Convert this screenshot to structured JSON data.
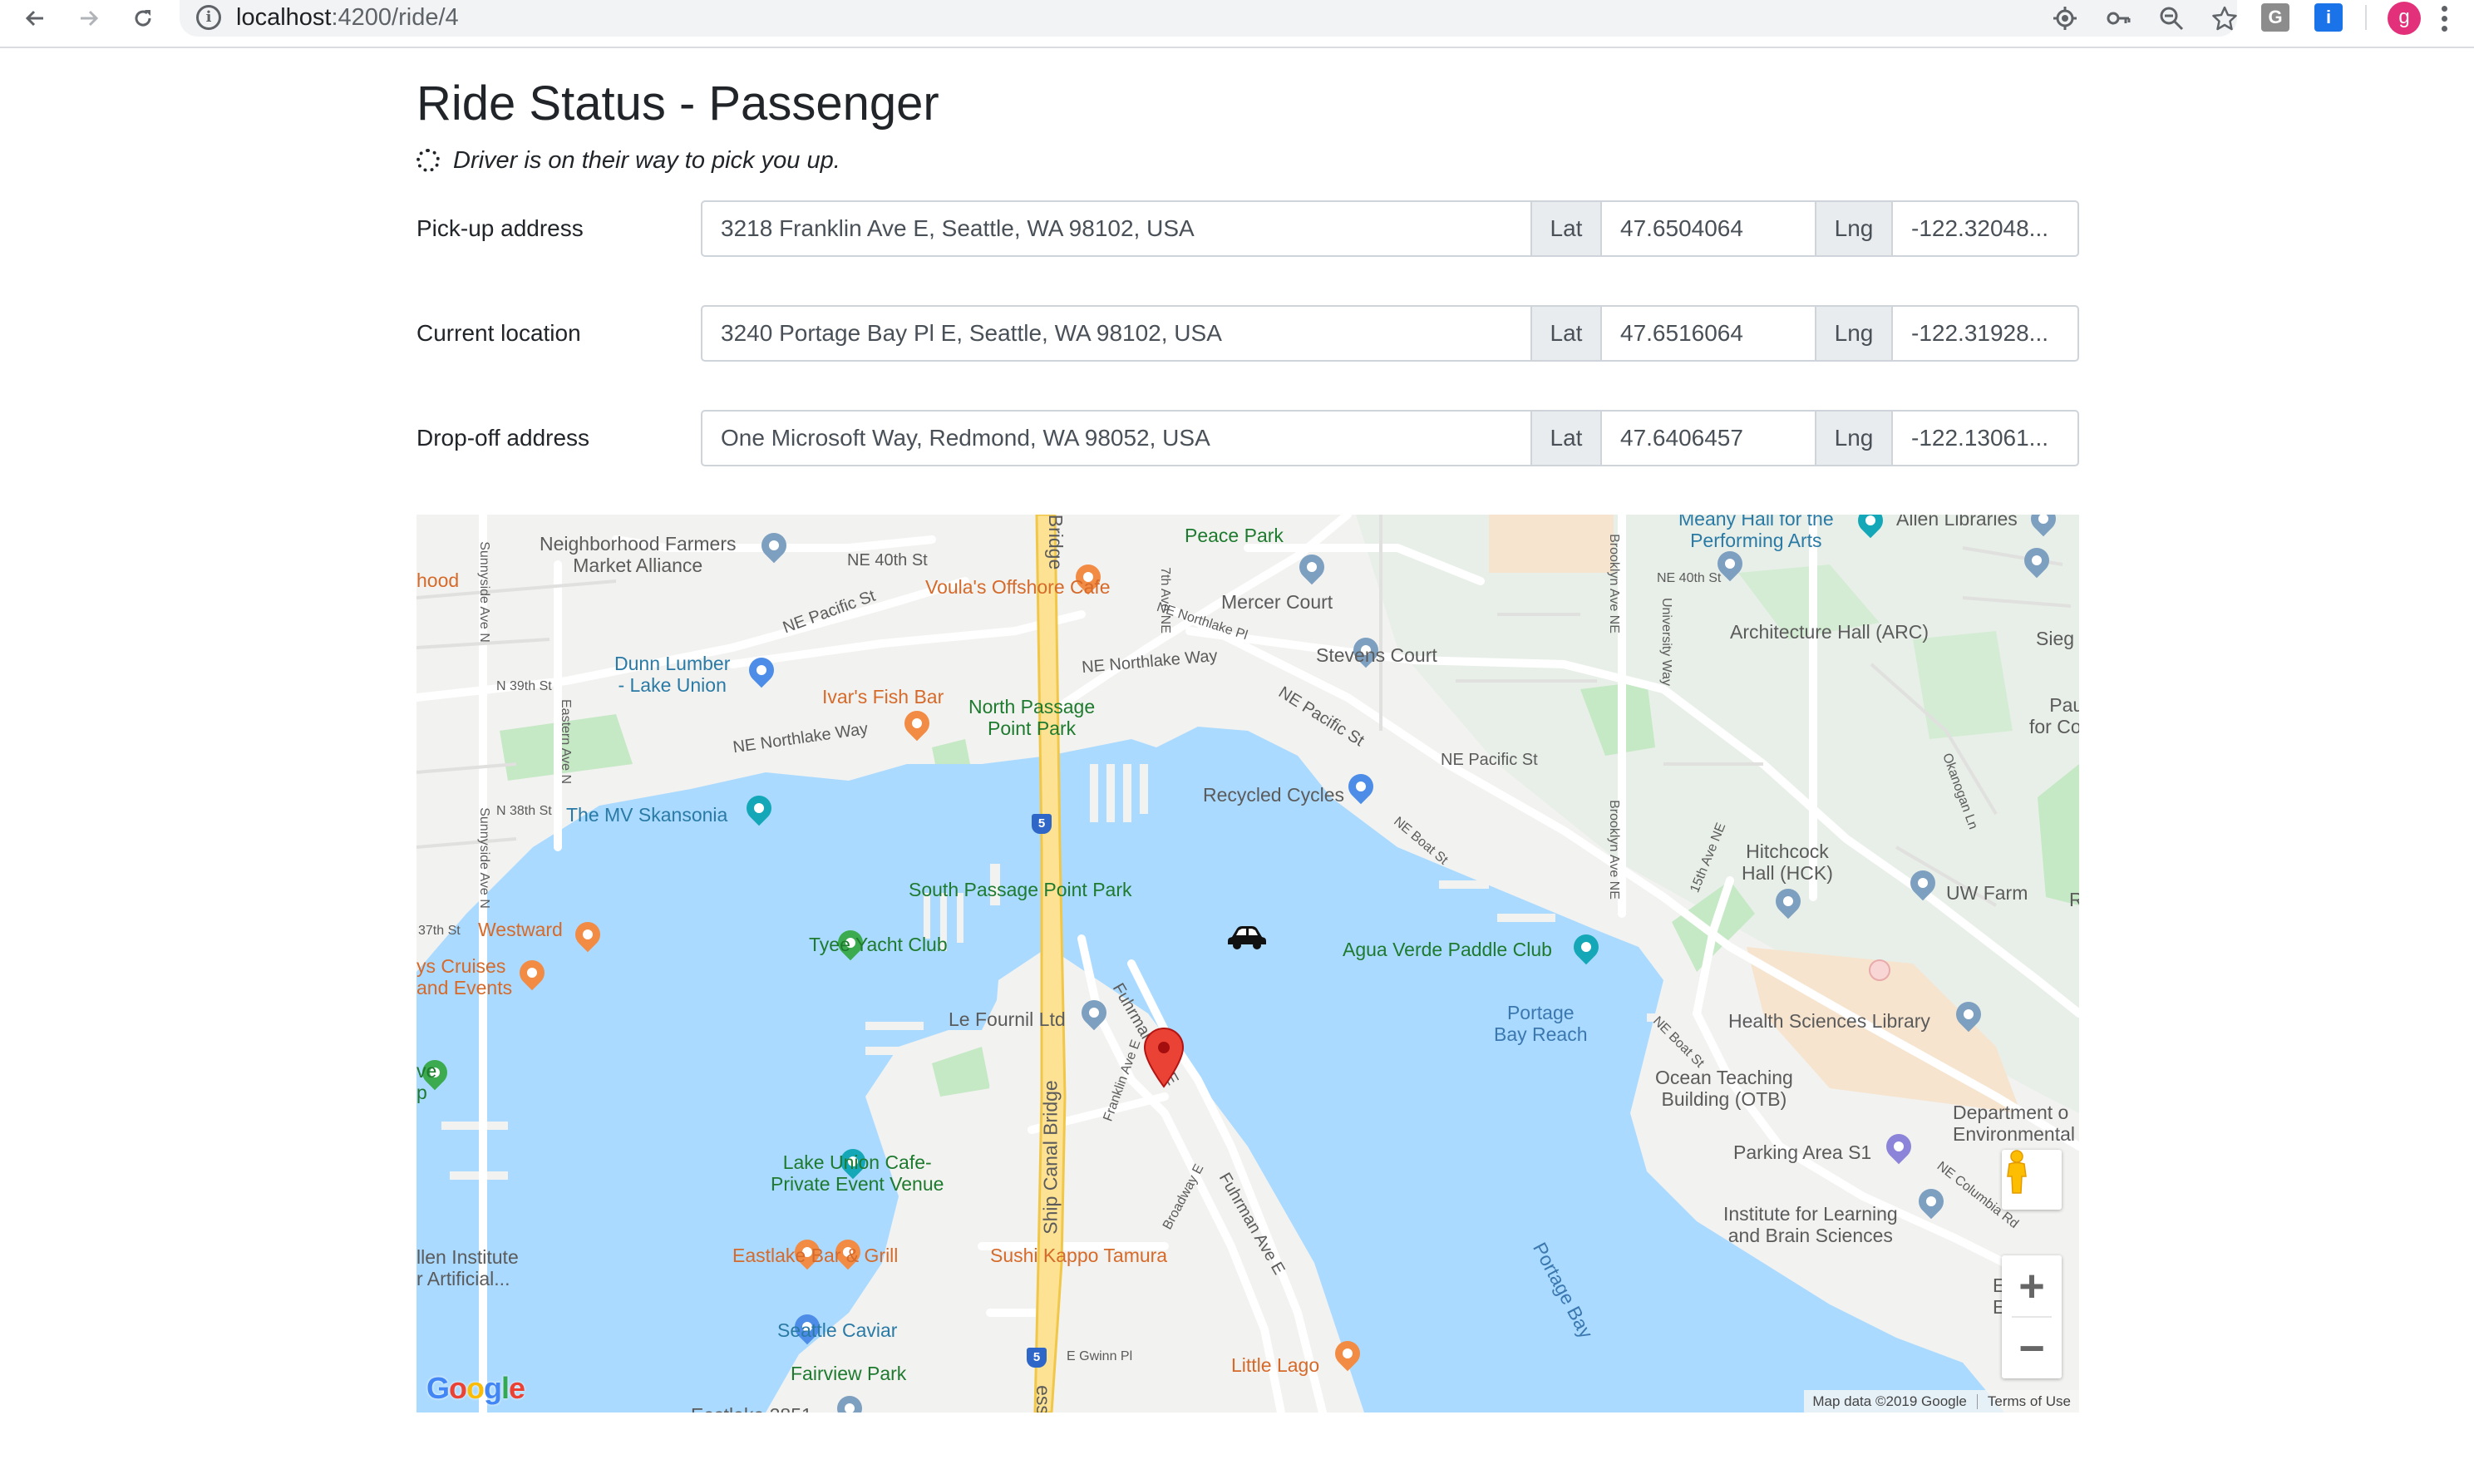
{
  "browser": {
    "url_host": "localhost",
    "url_path": ":4200/ride/4",
    "icons": [
      "back-arrow-icon",
      "forward-arrow-icon",
      "reload-icon",
      "info-icon",
      "location-target-icon",
      "key-icon",
      "zoom-out-icon",
      "star-icon"
    ],
    "extensions": [
      {
        "letter": "G",
        "color": "#8c8c8c"
      },
      {
        "letter": "i",
        "color": "#1a73e8"
      }
    ],
    "profile_initial": "g",
    "profile_color": "#e2317a"
  },
  "page": {
    "title": "Ride Status - Passenger",
    "status_text": "Driver is on their way to pick you up."
  },
  "rows": [
    {
      "label": "Pick-up address",
      "address": "3218 Franklin Ave E, Seattle, WA 98102, USA",
      "lat_label": "Lat",
      "lat": "47.6504064",
      "lng_label": "Lng",
      "lng": "-122.32048..."
    },
    {
      "label": "Current location",
      "address": "3240 Portage Bay Pl E, Seattle, WA 98102, USA",
      "lat_label": "Lat",
      "lat": "47.6516064",
      "lng_label": "Lng",
      "lng": "-122.31928..."
    },
    {
      "label": "Drop-off address",
      "address": "One Microsoft Way, Redmond, WA 98052, USA",
      "lat_label": "Lat",
      "lat": "47.6406457",
      "lng_label": "Lng",
      "lng": "-122.13061..."
    }
  ],
  "map": {
    "labels": {
      "neighborhood_farmers": "Neighborhood Farmers\nMarket Alliance",
      "ne_40th": "NE 40th St",
      "peace_park": "Peace Park",
      "meany_hall": "Meany Hall for the\nPerforming Arts",
      "allen_libraries": "Allen Libraries",
      "hood": "hood",
      "voulas": "Voula's Offshore Cafe",
      "ne_pacific_st_left": "NE Pacific St",
      "mercer_court": "Mercer Court",
      "ne_northlake_pl": "NE Northlake Pl",
      "ne_40th_right": "NE 40th St",
      "architecture_hall": "Architecture Hall (ARC)",
      "sieg": "Sieg",
      "dunn_lumber": "Dunn Lumber\n- Lake Union",
      "n_39th": "N 39th St",
      "stevens_court": "Stevens Court",
      "ne_northlake_way_right": "NE Northlake Way",
      "paul": "Paul\nfor Comp",
      "ivars": "Ivar's Fish Bar",
      "north_passage": "North Passage\nPoint Park",
      "ne_pacific_st_mid": "NE Pacific St",
      "ne_northlake_way_left": "NE Northlake Way",
      "ne_pacific_st_right": "NE Pacific St",
      "n_38th": "N 38th St",
      "mv_skansonia": "The MV Skansonia",
      "recycled_cycles": "Recycled Cycles",
      "ne_boat_st_top": "NE Boat St",
      "hitchcock": "Hitchcock\nHall (HCK)",
      "south_passage": "South Passage Point Park",
      "uw_farm": "UW Farm",
      "r_edge": "R",
      "w_37th": "37th St",
      "westward": "Westward",
      "tyee": "Tyee Yacht Club",
      "agua_verde": "Agua Verde Paddle Club",
      "cruises": "ys Cruises\nand Events",
      "le_fournil": "Le Fournil Ltd",
      "portage_bay_reach": "Portage\nBay Reach",
      "health_sciences": "Health Sciences Library",
      "ne_boat_st_bottom": "NE Boat St",
      "ve_p": "ve\np",
      "ocean_teaching": "Ocean Teaching\nBuilding (OTB)",
      "department": "Department o\nEnvironmental",
      "parking_area": "Parking Area S1",
      "lake_union_cafe": "Lake Union Cafe-\nPrivate Event Venue",
      "ne_columbia": "NE Columbia Rd",
      "institute_learning": "Institute for Learning\nand Brain Sciences",
      "allen_institute": "llen Institute\nr Artificial...",
      "eastlake_bar": "Eastlake Bar & Grill",
      "sushi_kappo": "Sushi Kappo Tamura",
      "portage_bay": "Portage Bay",
      "e_ne": "E ne\nE or",
      "seattle_caviar": "Seattle Caviar",
      "e_gwinn": "E Gwinn Pl",
      "little_lago": "Little Lago",
      "fairview_park": "Fairview Park",
      "eastlake_2851": "Eastlake 2851",
      "ship_canal_bridge": "Ship Canal Bridge",
      "bridge_top": "Bridge",
      "ess": "ess",
      "franklin_ave": "Franklin Ave E",
      "fuhrman_top": "Fuhrman Ave E",
      "fuhrman_bottom": "Fuhrman Ave E",
      "broadway": "Broadway E",
      "sunnyside_top": "Sunnyside Ave N",
      "sunnyside_bottom": "Sunnyside Ave N",
      "eastern_ave": "Eastern Ave N",
      "seventh_ave": "7th Ave NE",
      "brooklyn_top": "Brooklyn Ave NE",
      "brooklyn_bottom": "Brooklyn Ave NE",
      "university_way": "University Way",
      "fifteenth_ave": "15th Ave NE",
      "okanogan": "Okanogan Ln",
      "interstate": "5"
    },
    "google_logo": "Google",
    "map_data": "Map data ©2019 Google",
    "terms": "Terms of Use",
    "zoom_in": "+",
    "zoom_out": "−",
    "colors": {
      "water": "#aadaff",
      "land": "#f2f2f0",
      "park": "#c5e8c5",
      "campus": "#e8efe8",
      "highway": "#fde293",
      "marker": "#ea4335"
    }
  }
}
